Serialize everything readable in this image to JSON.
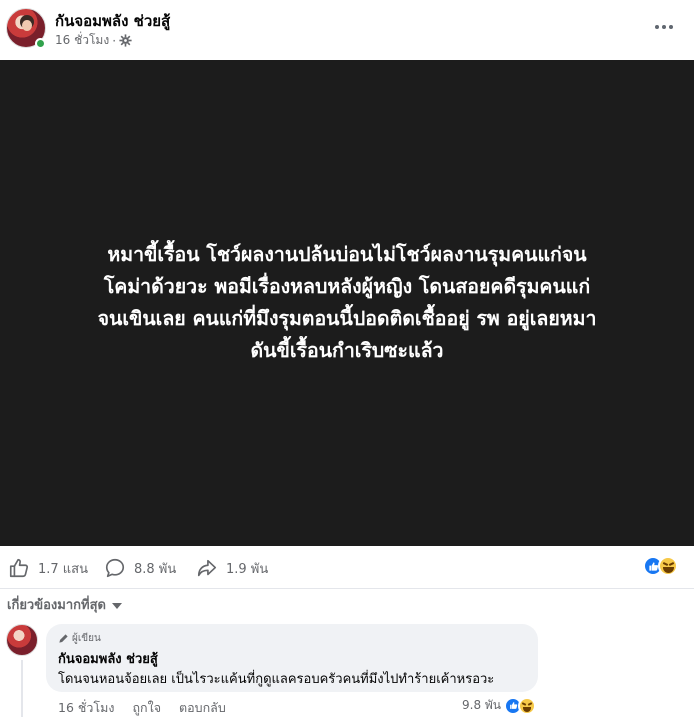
{
  "header": {
    "author_name": "กันจอมพลัง ช่วยสู้",
    "time": "16 ชั่วโมง",
    "separator": "·",
    "privacy_icon": "gear-icon",
    "more_icon": "more-horizontal-icon"
  },
  "post": {
    "image_text_lines": [
      "หมาขี้เรื้อน โชว์ผลงานปล้นบ่อนไม่โชว์ผลงานรุมคนแก่จน",
      "โคม่าด้วยวะ พอมีเรื่องหลบหลังผู้หญิง โดนสอยคดีรุมคนแก่",
      "จนเขินเลย คนแก่ที่มึงรุมตอนนี้ปอดติดเชื้ออยู่ รพ อยู่เลยหมา",
      "ดันขี้เรื้อนกำเริบซะแล้ว"
    ],
    "background_color": "#1c1c1c"
  },
  "actions": {
    "likes": "1.7 แสน",
    "comments": "8.8 พัน",
    "shares": "1.9 พัน",
    "like_icon": "thumbs-up-icon",
    "comment_icon": "comment-icon",
    "share_icon": "share-icon",
    "reaction_icons": [
      "like-reaction-icon",
      "haha-reaction-icon"
    ]
  },
  "sort": {
    "label": "เกี่ยวข้องมากที่สุด"
  },
  "comment": {
    "badge": "ผู้เขียน",
    "author_name": "กันจอมพลัง ช่วยสู้",
    "text": "โดนจนหอนจ้อยเลย เป็นไรวะแค้นที่กูดูแลครอบครัวคนที่มึงไปทำร้ายเค้าหรอวะ",
    "time": "16 ชั่วโมง",
    "like_label": "ถูกใจ",
    "reply_label": "ตอบกลับ",
    "reaction_count": "9.8 พัน"
  },
  "colors": {
    "accent": "#1877f2",
    "online": "#31a24c",
    "secondary_text": "#65676b"
  }
}
